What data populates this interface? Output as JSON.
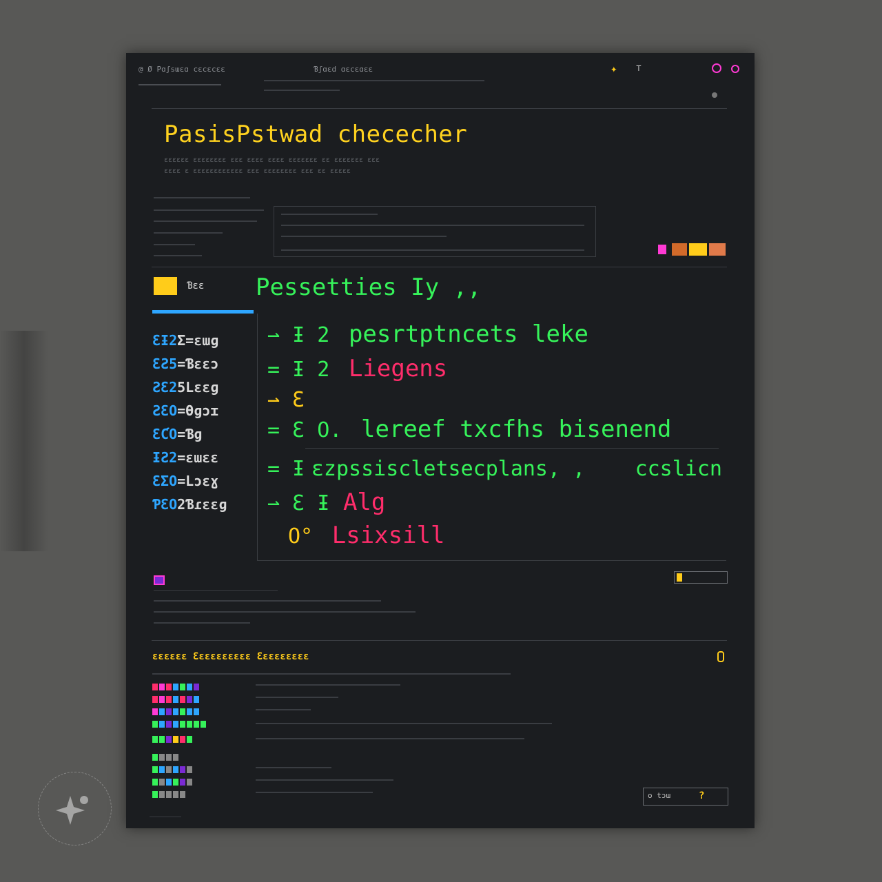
{
  "window": {
    "titlebar": {
      "left_text": "@ Ø Pɑʃsɯɛɑ cɛcɛcɛɛ",
      "center_text": "Ɓʃɑɛd ɑɛcɛɑɛɛ",
      "right_icons": [
        "star-icon",
        "tool-icon",
        "magenta-circle-icon",
        "magenta-ring-icon"
      ]
    }
  },
  "header": {
    "title": "PasisPstwad chececher",
    "subtitle_lines": [
      "ɛɛɛɛɛɛ ɛɛɛɛɛɛɛɛ ɛɛɛ ɛɛɛɛ ɛɛɛɛ ɛɛɛɛɛɛɛ ɛɛ ɛɛɛɛɛɛɛ ɛɛɛ",
      "ɛɛɛɛ ɛ ɛɛɛɛɛɛɛɛɛɛɛɛ ɛɛɛ ɛɛɛɛɛɛɛɛ ɛɛɛ ɛɛ ɛɛɛɛɛ"
    ]
  },
  "section": {
    "title": "Pessetties Iy ,,",
    "tab_label": "Ɓɛɛ"
  },
  "sidebar": {
    "items": [
      {
        "num": "ƐƗ2",
        "label": "Ʃ=ɛɯɡ"
      },
      {
        "num": "ƐƧ5",
        "label": "=Ɓɛɛɔ"
      },
      {
        "num": "ƧƐ2",
        "label": "5Lɛɛɡ"
      },
      {
        "num": "ƧƐO",
        "label": "=Ɵɡɔɪ"
      },
      {
        "num": "ƐƇO",
        "label": "=Ɓɡ"
      },
      {
        "num": "ƗƧ2",
        "label": "=ɛɯɛɛ"
      },
      {
        "num": "ƐƩO",
        "label": "=Lɔɛɣ"
      },
      {
        "num": "ƤƐO",
        "label": "2Ɓɾɛɛɡ"
      }
    ]
  },
  "results": [
    {
      "prefix": "⇀ Ɨ 2",
      "text": "pesrtptncets leke",
      "color": "green"
    },
    {
      "prefix": "= Ɨ 2",
      "text": "Liegens",
      "color": "pink"
    },
    {
      "prefix": "⇀ Ɛ",
      "text": "",
      "color": "green"
    },
    {
      "prefix": "= Ɛ O.",
      "text": "lereef txcfhs bisenend",
      "color": "green"
    },
    {
      "prefix": "= Ɨ",
      "text": "ɛzpssiscletsecplans, ,",
      "extra": "ccslicn",
      "color": "green"
    },
    {
      "prefix": "⇀ Ɛ Ɨ",
      "text": "Alg",
      "color": "pink"
    },
    {
      "prefix": "O°",
      "text": "Lsixsill",
      "color": "pink"
    }
  ],
  "footer": {
    "log_title": "ɛɛɛɛɛɛ Ɛɛɛɛɛɛɛɛɛɛ Ɛɛɛɛɛɛɛɛɛ",
    "search_placeholder": "o tɔɯ",
    "help_label": "?"
  },
  "colors": {
    "background": "#585856",
    "window": "#1b1d20",
    "accent_yellow": "#ffd21f",
    "accent_green": "#36f25a",
    "accent_pink": "#ff2d6b",
    "accent_blue": "#2ea6ff",
    "accent_magenta": "#ff3ad4"
  }
}
